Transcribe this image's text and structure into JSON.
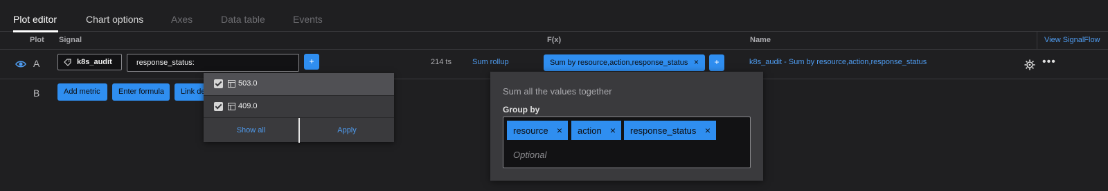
{
  "tabs": [
    "Plot editor",
    "Chart options",
    "Axes",
    "Data table",
    "Events"
  ],
  "columns": {
    "plot": "Plot",
    "signal": "Signal",
    "fx": "F(x)",
    "name": "Name",
    "view_signalflow": "View SignalFlow"
  },
  "row_a": {
    "letter": "A",
    "metric": "k8s_audit",
    "filter_value": "response_status:",
    "add_filter": "+",
    "ts_count": "214 ts",
    "rollup": "Sum rollup",
    "fx_chip": "Sum by resource,action,response_status",
    "fx_chip_close": "×",
    "add_fx": "+",
    "name": "k8s_audit - Sum by resource,action,response_status",
    "more": "•••"
  },
  "row_b": {
    "letter": "B",
    "add_metric": "Add metric",
    "enter_formula": "Enter formula",
    "link_detector": "Link de"
  },
  "filter_dropdown": {
    "items": [
      {
        "label": "503.0",
        "checked": true
      },
      {
        "label": "409.0",
        "checked": true
      }
    ],
    "show_all": "Show all",
    "apply": "Apply"
  },
  "fx_popover": {
    "description": "Sum all the values together",
    "group_by_label": "Group by",
    "group_by_chips": [
      "resource",
      "action",
      "response_status"
    ],
    "chip_close": "×",
    "placeholder": "Optional"
  },
  "colors": {
    "accent": "#2f8ef0",
    "link": "#4f9cf0",
    "background": "#1f1f21",
    "panel": "#3a3a3d"
  },
  "icons": [
    "eye-icon",
    "tag-icon",
    "table-icon",
    "gear-icon",
    "more-icon",
    "close-icon"
  ]
}
